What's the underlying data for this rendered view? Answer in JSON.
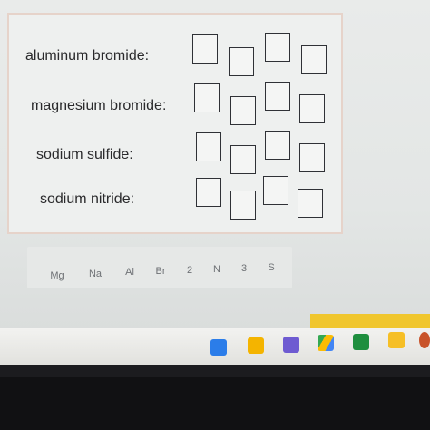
{
  "rows": [
    {
      "label": "aluminum bromide:"
    },
    {
      "label": "magnesium bromide:"
    },
    {
      "label": "sodium sulfide:"
    },
    {
      "label": "sodium nitride:"
    }
  ],
  "tiles": [
    "Mg",
    "Na",
    "Al",
    "Br",
    "2",
    "N",
    "3",
    "S"
  ],
  "colors": {
    "panel_border": "#e6d3ca",
    "accent": "#f0c62e",
    "text": "#2a2a2c"
  },
  "taskbar_icons": [
    {
      "icon": "files-icon",
      "color": "#2b7de9"
    },
    {
      "icon": "docs-icon",
      "color": "#f4b400"
    },
    {
      "icon": "classroom-icon",
      "color": "#2b8a3e"
    },
    {
      "icon": "forms-icon",
      "color": "#6e5bd1"
    },
    {
      "icon": "drive-icon",
      "color": "#34a853"
    },
    {
      "icon": "slides-icon",
      "color": "#1e8e3e"
    },
    {
      "icon": "keep-icon",
      "color": "#f6bf26"
    },
    {
      "icon": "account-icon",
      "color": "#c8532a"
    }
  ]
}
